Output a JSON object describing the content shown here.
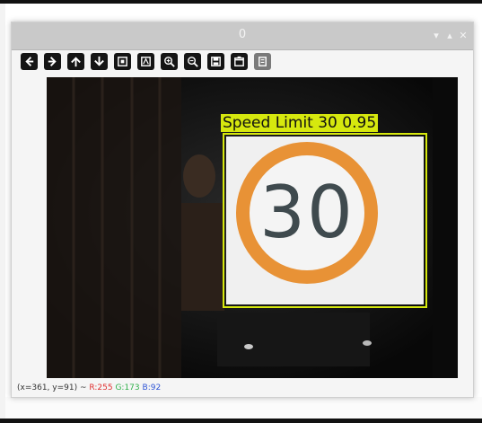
{
  "window": {
    "title": "0",
    "controls": {
      "minimize": "▾",
      "maximize": "▴",
      "close": "✕"
    }
  },
  "toolbar": {
    "buttons": [
      {
        "name": "pan-left",
        "icon": "arrow-left-icon"
      },
      {
        "name": "pan-right",
        "icon": "arrow-right-icon"
      },
      {
        "name": "pan-up",
        "icon": "arrow-up-icon"
      },
      {
        "name": "pan-down",
        "icon": "arrow-down-icon"
      },
      {
        "name": "zoom-fit",
        "icon": "zoom-fit-icon"
      },
      {
        "name": "zoom-original",
        "icon": "zoom-original-icon"
      },
      {
        "name": "zoom-in",
        "icon": "zoom-in-icon"
      },
      {
        "name": "zoom-out",
        "icon": "zoom-out-icon"
      },
      {
        "name": "save",
        "icon": "save-icon"
      },
      {
        "name": "properties",
        "icon": "properties-icon"
      },
      {
        "name": "overlay",
        "icon": "overlay-icon"
      }
    ]
  },
  "detection": {
    "label": "Speed Limit 30 0.95",
    "box_color": "#d6e80e",
    "sign_text": "30",
    "ring_color": "#e89236"
  },
  "status": {
    "coords": "(x=361, y=91) ~",
    "r": "R:255",
    "g": "G:173",
    "b": "B:92"
  }
}
